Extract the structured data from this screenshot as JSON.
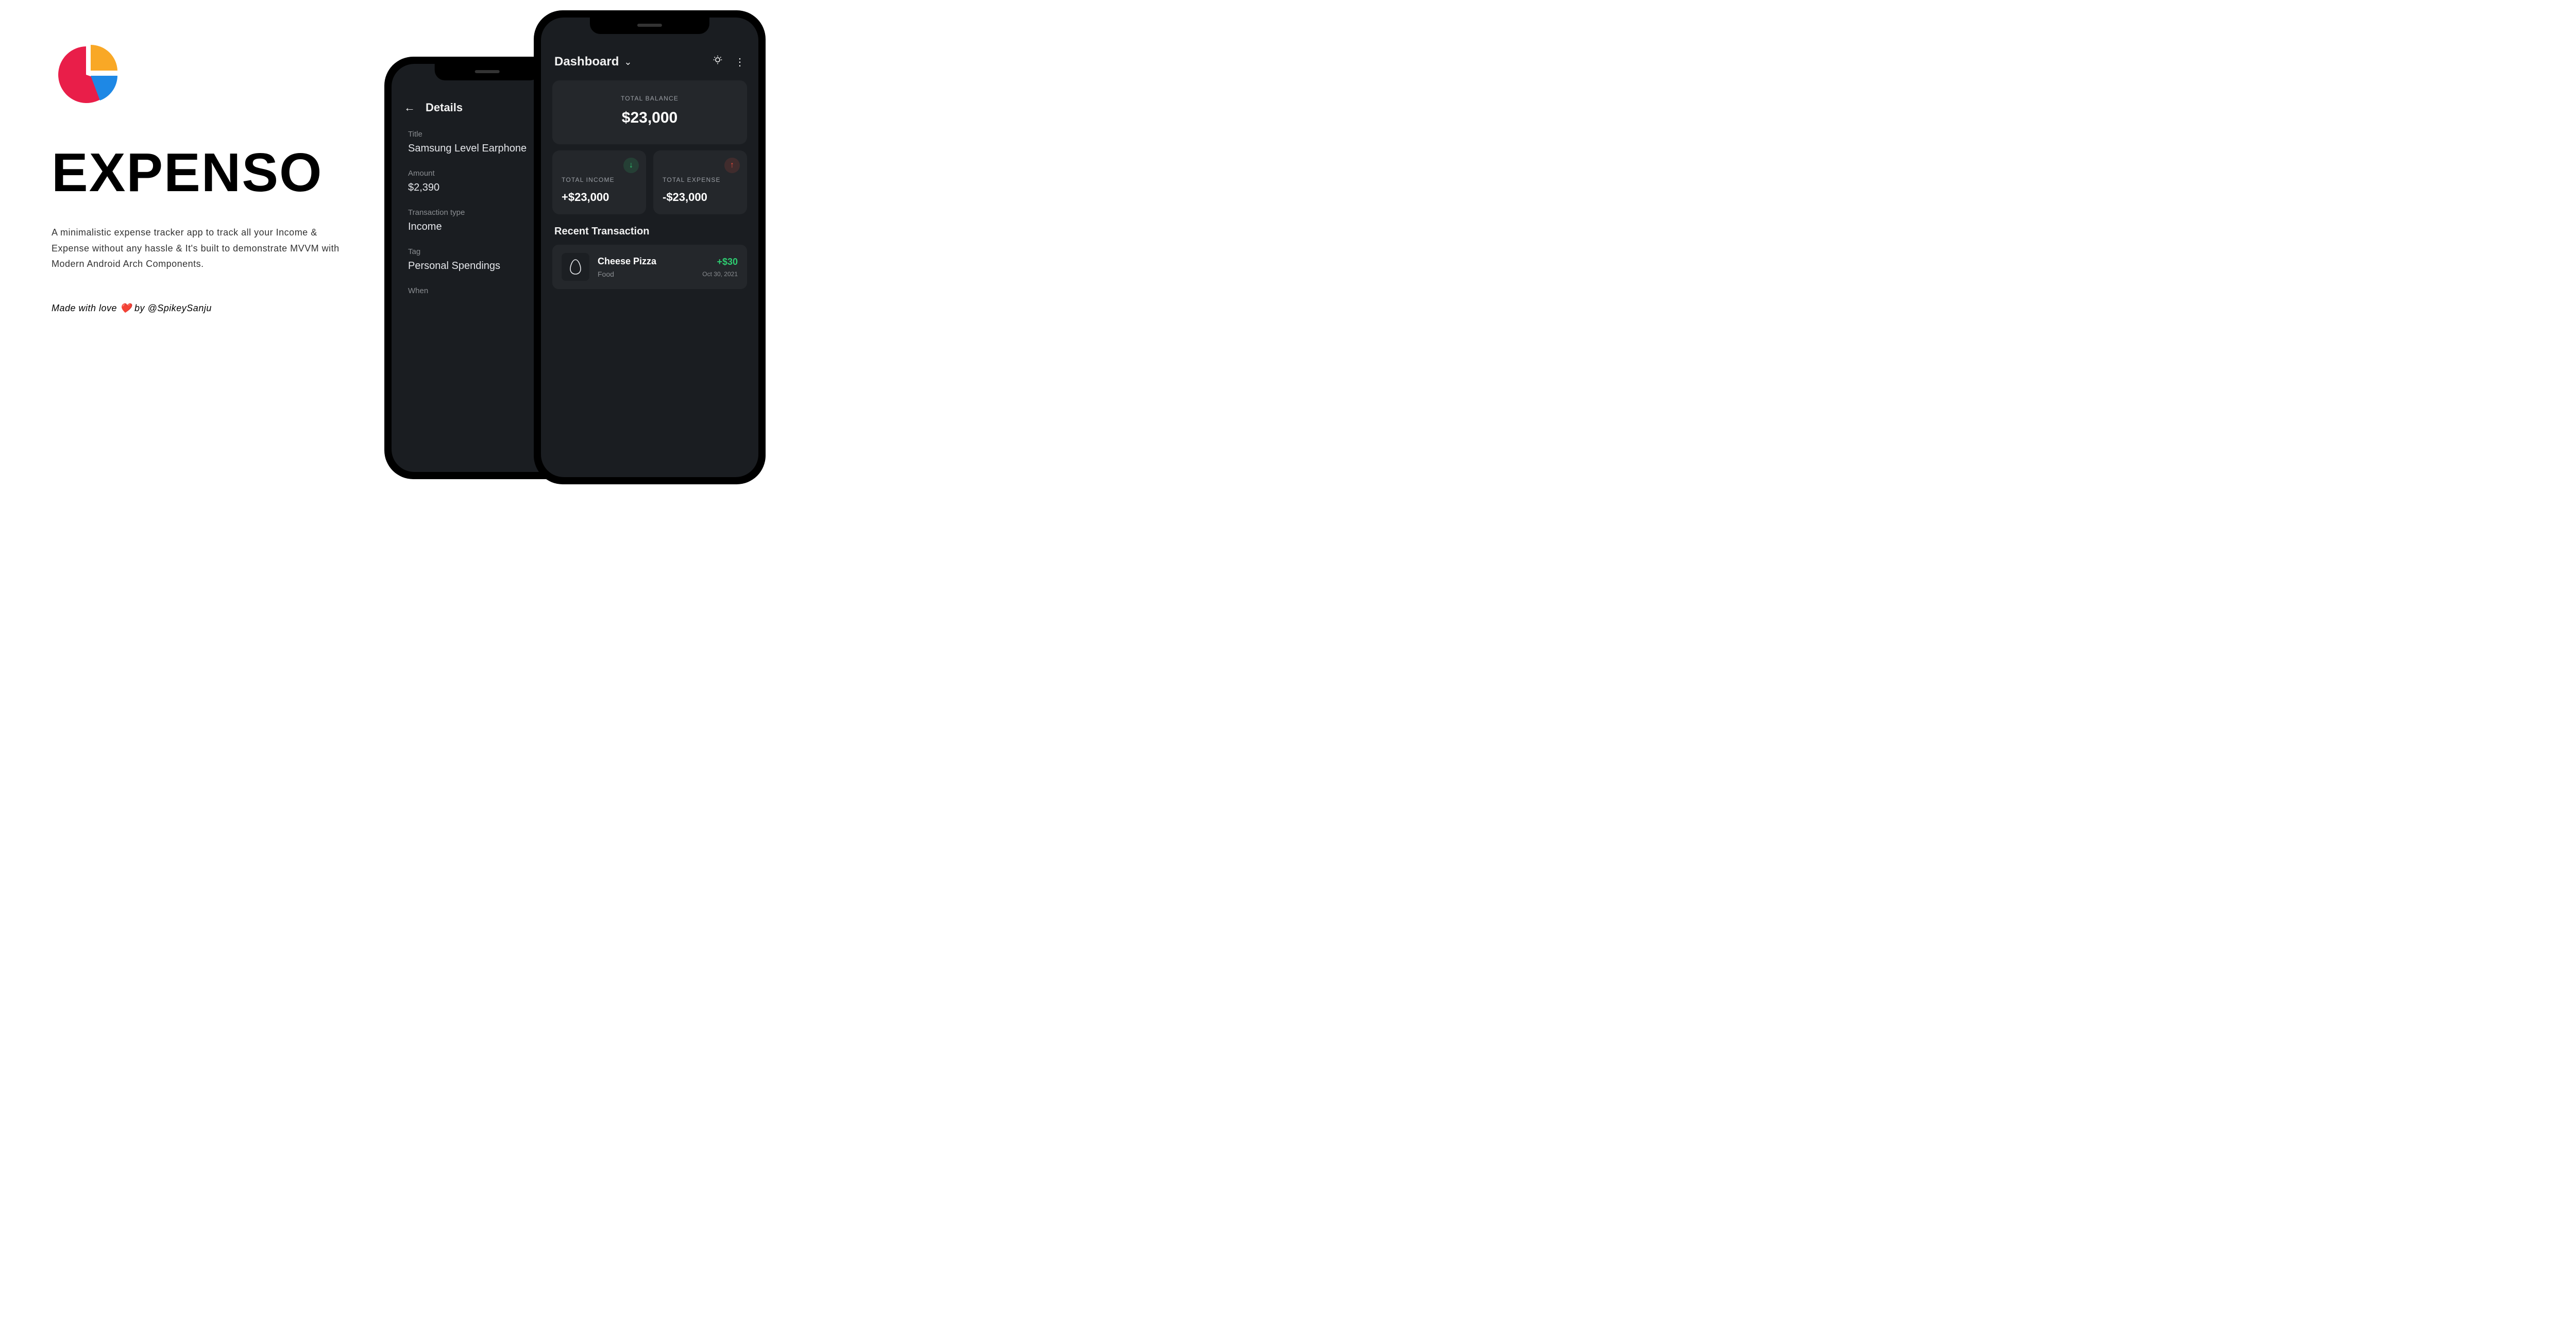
{
  "hero": {
    "app_name": "EXPENSO",
    "tagline": "A minimalistic expense tracker app to track all your Income & Expense without any hassle & It's built to demonstrate MVVM with Modern Android Arch Components.",
    "credit_prefix": "Made with love ",
    "credit_heart": "❤️",
    "credit_suffix": " by @SpikeySanju"
  },
  "logo_colors": {
    "red": "#E91E49",
    "orange": "#F9A826",
    "blue": "#1E88E5"
  },
  "details": {
    "header_title": "Details",
    "fields": [
      {
        "label": "Title",
        "value": "Samsung Level Earphone"
      },
      {
        "label": "Amount",
        "value": "$2,390"
      },
      {
        "label": "Transaction type",
        "value": "Income"
      },
      {
        "label": "Tag",
        "value": "Personal Spendings"
      },
      {
        "label": "When",
        "value": ""
      }
    ]
  },
  "dashboard": {
    "title": "Dashboard",
    "balance": {
      "label": "TOTAL BALANCE",
      "value": "$23,000"
    },
    "income": {
      "label": "TOTAL INCOME",
      "value": "+$23,000"
    },
    "expense": {
      "label": "TOTAL EXPENSE",
      "value": "-$23,000"
    },
    "recent_title": "Recent Transaction",
    "transactions": [
      {
        "name": "Cheese Pizza",
        "category": "Food",
        "amount": "+$30",
        "date": "Oct 30, 2021",
        "icon": "egg"
      }
    ]
  }
}
